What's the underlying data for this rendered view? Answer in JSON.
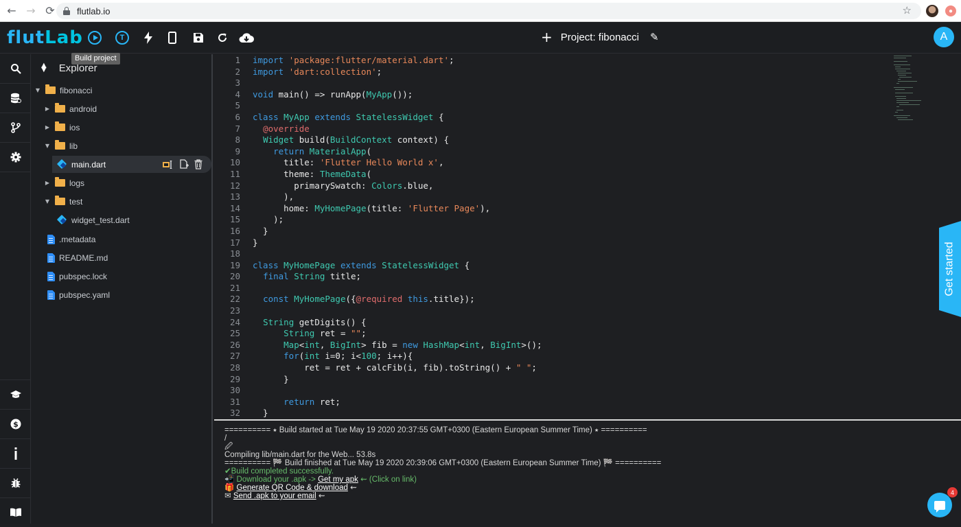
{
  "browser": {
    "url": "flutlab.io",
    "back_icon": "←",
    "forward_icon": "→",
    "reload_icon": "⟳",
    "star_icon": "☆",
    "ext_label": "●"
  },
  "header": {
    "logo_part1": "flut",
    "logo_part2": "Lab",
    "tooltip": "Build project",
    "project_title": "Project: fibonacci",
    "plus_icon": "+",
    "pencil_icon": "✎",
    "user_initial": "A",
    "hot_reload_letter": "T",
    "icons": [
      "build-project-icon",
      "hot-reload-icon",
      "flash-icon",
      "device-icon",
      "save-icon",
      "refresh-icon",
      "cloud-download-icon"
    ]
  },
  "sidebar": {
    "icons": [
      "search-icon",
      "database-icon",
      "git-branch-icon",
      "settings-icon",
      "school-icon",
      "dollar-icon",
      "info-icon",
      "bug-icon",
      "book-icon"
    ]
  },
  "explorer": {
    "title": "Explorer",
    "items": [
      {
        "label": "fibonacci",
        "type": "folder",
        "open": true
      },
      {
        "label": "android",
        "type": "folder",
        "open": false
      },
      {
        "label": "ios",
        "type": "folder",
        "open": false
      },
      {
        "label": "lib",
        "type": "folder",
        "open": true
      },
      {
        "label": "main.dart",
        "type": "dart",
        "selected": true
      },
      {
        "label": "logs",
        "type": "folder",
        "open": false
      },
      {
        "label": "test",
        "type": "folder",
        "open": true
      },
      {
        "label": "widget_test.dart",
        "type": "dart"
      },
      {
        "label": ".metadata",
        "type": "file"
      },
      {
        "label": "README.md",
        "type": "file"
      },
      {
        "label": "pubspec.lock",
        "type": "file"
      },
      {
        "label": "pubspec.yaml",
        "type": "file"
      }
    ]
  },
  "editor": {
    "lines": [
      [
        [
          "k",
          "import "
        ],
        [
          "s",
          "'package:flutter/material.dart'"
        ],
        [
          "p",
          ";"
        ]
      ],
      [
        [
          "k",
          "import "
        ],
        [
          "s",
          "'dart:collection'"
        ],
        [
          "p",
          ";"
        ]
      ],
      [],
      [
        [
          "k",
          "void"
        ],
        [
          "p",
          " main() => runApp("
        ],
        [
          "t",
          "MyApp"
        ],
        [
          "p",
          "());"
        ]
      ],
      [],
      [
        [
          "k",
          "class "
        ],
        [
          "t",
          "MyApp "
        ],
        [
          "k",
          "extends "
        ],
        [
          "t",
          "StatelessWidget"
        ],
        [
          "p",
          " {"
        ]
      ],
      [
        [
          "p",
          "  "
        ],
        [
          "a",
          "@override"
        ]
      ],
      [
        [
          "p",
          "  "
        ],
        [
          "t",
          "Widget"
        ],
        [
          "p",
          " build("
        ],
        [
          "t",
          "BuildContext"
        ],
        [
          "p",
          " context) {"
        ]
      ],
      [
        [
          "p",
          "    "
        ],
        [
          "k",
          "return "
        ],
        [
          "t",
          "MaterialApp"
        ],
        [
          "p",
          "("
        ]
      ],
      [
        [
          "p",
          "      title: "
        ],
        [
          "s",
          "'Flutter Hello World x'"
        ],
        [
          "p",
          ","
        ]
      ],
      [
        [
          "p",
          "      theme: "
        ],
        [
          "t",
          "ThemeData"
        ],
        [
          "p",
          "("
        ]
      ],
      [
        [
          "p",
          "        primarySwatch: "
        ],
        [
          "t",
          "Colors"
        ],
        [
          "p",
          ".blue,"
        ]
      ],
      [
        [
          "p",
          "      ),"
        ]
      ],
      [
        [
          "p",
          "      home: "
        ],
        [
          "t",
          "MyHomePage"
        ],
        [
          "p",
          "(title: "
        ],
        [
          "s",
          "'Flutter Page'"
        ],
        [
          "p",
          "),"
        ]
      ],
      [
        [
          "p",
          "    );"
        ]
      ],
      [
        [
          "p",
          "  }"
        ]
      ],
      [
        [
          "p",
          "}"
        ]
      ],
      [],
      [
        [
          "k",
          "class "
        ],
        [
          "t",
          "MyHomePage "
        ],
        [
          "k",
          "extends "
        ],
        [
          "t",
          "StatelessWidget"
        ],
        [
          "p",
          " {"
        ]
      ],
      [
        [
          "p",
          "  "
        ],
        [
          "k",
          "final "
        ],
        [
          "t",
          "String"
        ],
        [
          "p",
          " title;"
        ]
      ],
      [],
      [
        [
          "p",
          "  "
        ],
        [
          "k",
          "const "
        ],
        [
          "t",
          "MyHomePage"
        ],
        [
          "p",
          "({"
        ],
        [
          "a",
          "@required "
        ],
        [
          "k",
          "this"
        ],
        [
          "p",
          ".title});"
        ]
      ],
      [],
      [
        [
          "p",
          "  "
        ],
        [
          "t",
          "String"
        ],
        [
          "p",
          " getDigits() {"
        ]
      ],
      [
        [
          "p",
          "      "
        ],
        [
          "t",
          "String"
        ],
        [
          "p",
          " ret = "
        ],
        [
          "s",
          "\"\""
        ],
        [
          "p",
          ";"
        ]
      ],
      [
        [
          "p",
          "      "
        ],
        [
          "t",
          "Map"
        ],
        [
          "p",
          "<"
        ],
        [
          "t",
          "int"
        ],
        [
          "p",
          ", "
        ],
        [
          "t",
          "BigInt"
        ],
        [
          "p",
          "> fib = "
        ],
        [
          "k",
          "new "
        ],
        [
          "t",
          "HashMap"
        ],
        [
          "p",
          "<"
        ],
        [
          "t",
          "int"
        ],
        [
          "p",
          ", "
        ],
        [
          "t",
          "BigInt"
        ],
        [
          "p",
          ">();"
        ]
      ],
      [
        [
          "p",
          "      "
        ],
        [
          "k",
          "for"
        ],
        [
          "p",
          "("
        ],
        [
          "t",
          "int"
        ],
        [
          "p",
          " i=0; i<"
        ],
        [
          "t",
          "100"
        ],
        [
          "p",
          "; i++){"
        ]
      ],
      [
        [
          "p",
          "          ret = ret + calcFib(i, fib).toString() + "
        ],
        [
          "s",
          "\" \""
        ],
        [
          "p",
          ";"
        ]
      ],
      [
        [
          "p",
          "      }"
        ]
      ],
      [],
      [
        [
          "p",
          "      "
        ],
        [
          "k",
          "return"
        ],
        [
          "p",
          " ret;"
        ]
      ],
      [
        [
          "p",
          "  }"
        ]
      ]
    ],
    "get_started": "Get started"
  },
  "console": {
    "lines": [
      {
        "text": "========== ⭑ Build started at Tue May 19 2020 20:37:55 GMT+0300 (Eastern European Summer Time) ⭑ ==========",
        "style": "plain"
      },
      {
        "text": "/",
        "style": "plain"
      },
      {
        "text": "🖉",
        "style": "plain"
      },
      {
        "text": "Compiling lib/main.dart for the Web... 53.8s",
        "style": "plain"
      },
      {
        "text": "========== 🏁 Build finished at Tue May 19 2020 20:39:06 GMT+0300 (Eastern European Summer Time) 🏁 ==========",
        "style": "plain"
      }
    ],
    "success": "✔Build completed successfully.",
    "download_prefix": "📲 Download your .apk -> ",
    "download_link": "Get my apk",
    "download_suffix": " ⇜ (Click on link)",
    "qr_prefix": "🎁 ",
    "qr_link": "Generate QR Code & download",
    "qr_suffix": " ⇜",
    "email_prefix": "✉ ",
    "email_link": "Send .apk to your email",
    "email_suffix": " ⇜"
  },
  "chat": {
    "badge": "4"
  },
  "colors": {
    "accent": "#29b6f6",
    "folder": "#f0b04a",
    "keyword": "#3f9ae0",
    "string": "#e8885a",
    "type": "#3fc9b0",
    "annotation": "#e06c6c"
  }
}
